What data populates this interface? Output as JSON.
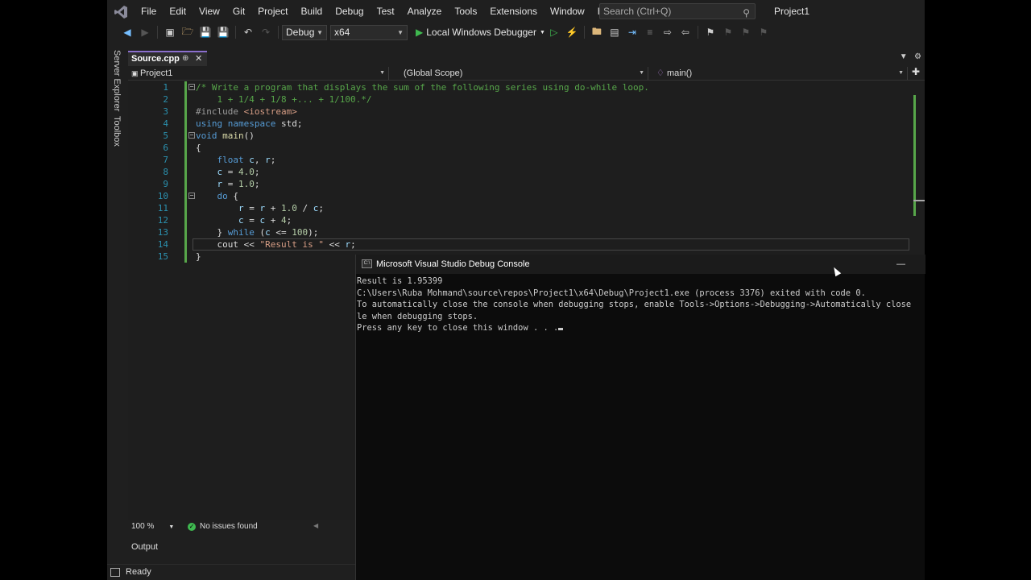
{
  "menu": {
    "items": [
      "File",
      "Edit",
      "View",
      "Git",
      "Project",
      "Build",
      "Debug",
      "Test",
      "Analyze",
      "Tools",
      "Extensions",
      "Window",
      "Help"
    ],
    "search_placeholder": "Search (Ctrl+Q)",
    "solution_name": "Project1"
  },
  "toolbar": {
    "configuration": "Debug",
    "platform": "x64",
    "run_label": "Local Windows Debugger"
  },
  "side_tabs": [
    "Server Explorer",
    "Toolbox"
  ],
  "tab": {
    "title": "Source.cpp"
  },
  "navbar": {
    "project": "Project1",
    "scope": "(Global Scope)",
    "member": "main()"
  },
  "code_lines": [
    {
      "n": "1",
      "tokens": [
        {
          "t": "/* Write a program that displays the sum of the following series using do-while loop.",
          "c": "cm"
        }
      ]
    },
    {
      "n": "2",
      "tokens": [
        {
          "t": "    1 + 1/4 + 1/8 +... + 1/100.*/",
          "c": "cm"
        }
      ]
    },
    {
      "n": "3",
      "tokens": [
        {
          "t": "#include ",
          "c": "pp"
        },
        {
          "t": "<iostream>",
          "c": "inc"
        }
      ]
    },
    {
      "n": "4",
      "tokens": [
        {
          "t": "using ",
          "c": "kw"
        },
        {
          "t": "namespace ",
          "c": "kw"
        },
        {
          "t": "std;",
          "c": "id"
        }
      ]
    },
    {
      "n": "5",
      "tokens": [
        {
          "t": "void ",
          "c": "kw"
        },
        {
          "t": "main",
          "c": "fn"
        },
        {
          "t": "()",
          "c": "id"
        }
      ]
    },
    {
      "n": "6",
      "tokens": [
        {
          "t": "{",
          "c": "id"
        }
      ]
    },
    {
      "n": "7",
      "tokens": [
        {
          "t": "    float ",
          "c": "kw"
        },
        {
          "t": "c",
          "c": "var"
        },
        {
          "t": ", ",
          "c": "id"
        },
        {
          "t": "r",
          "c": "var"
        },
        {
          "t": ";",
          "c": "id"
        }
      ]
    },
    {
      "n": "8",
      "tokens": [
        {
          "t": "    c",
          "c": "var"
        },
        {
          "t": " = ",
          "c": "id"
        },
        {
          "t": "4.0",
          "c": "nm"
        },
        {
          "t": ";",
          "c": "id"
        }
      ]
    },
    {
      "n": "9",
      "tokens": [
        {
          "t": "    r",
          "c": "var"
        },
        {
          "t": " = ",
          "c": "id"
        },
        {
          "t": "1.0",
          "c": "nm"
        },
        {
          "t": ";",
          "c": "id"
        }
      ]
    },
    {
      "n": "10",
      "tokens": [
        {
          "t": "    do ",
          "c": "kw"
        },
        {
          "t": "{",
          "c": "id"
        }
      ]
    },
    {
      "n": "11",
      "tokens": [
        {
          "t": "        r",
          "c": "var"
        },
        {
          "t": " = ",
          "c": "id"
        },
        {
          "t": "r",
          "c": "var"
        },
        {
          "t": " + ",
          "c": "id"
        },
        {
          "t": "1.0",
          "c": "nm"
        },
        {
          "t": " / ",
          "c": "id"
        },
        {
          "t": "c",
          "c": "var"
        },
        {
          "t": ";",
          "c": "id"
        }
      ]
    },
    {
      "n": "12",
      "tokens": [
        {
          "t": "        c",
          "c": "var"
        },
        {
          "t": " = ",
          "c": "id"
        },
        {
          "t": "c",
          "c": "var"
        },
        {
          "t": " + ",
          "c": "id"
        },
        {
          "t": "4",
          "c": "nm"
        },
        {
          "t": ";",
          "c": "id"
        }
      ]
    },
    {
      "n": "13",
      "tokens": [
        {
          "t": "    } ",
          "c": "id"
        },
        {
          "t": "while ",
          "c": "kw"
        },
        {
          "t": "(",
          "c": "id"
        },
        {
          "t": "c",
          "c": "var"
        },
        {
          "t": " <= ",
          "c": "id"
        },
        {
          "t": "100",
          "c": "nm"
        },
        {
          "t": ");",
          "c": "id"
        }
      ]
    },
    {
      "n": "14",
      "tokens": [
        {
          "t": "    cout ",
          "c": "id"
        },
        {
          "t": "<< ",
          "c": "id"
        },
        {
          "t": "\"Result is \"",
          "c": "st"
        },
        {
          "t": " << ",
          "c": "id"
        },
        {
          "t": "r",
          "c": "var"
        },
        {
          "t": ";",
          "c": "id"
        }
      ]
    },
    {
      "n": "15",
      "tokens": [
        {
          "t": "}",
          "c": "id"
        }
      ]
    }
  ],
  "editor_status": {
    "zoom": "100 %",
    "issues": "No issues found"
  },
  "output_panel": {
    "title": "Output"
  },
  "status_bar": {
    "text": "Ready"
  },
  "console": {
    "title": "Microsoft Visual Studio Debug Console",
    "lines": [
      "Result is 1.95399",
      "C:\\Users\\Ruba Mohmand\\source\\repos\\Project1\\x64\\Debug\\Project1.exe (process 3376) exited with code 0.",
      "To automatically close the console when debugging stops, enable Tools->Options->Debugging->Automatically close",
      "le when debugging stops.",
      "Press any key to close this window . . ."
    ]
  }
}
